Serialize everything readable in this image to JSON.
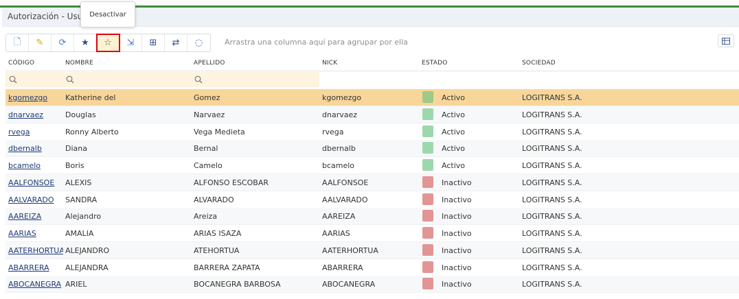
{
  "window": {
    "title": "Autorización - Usu",
    "top_glyph": "ꟸ"
  },
  "tooltip": {
    "text": "Desactivar"
  },
  "toolbar": {
    "buttons": [
      {
        "name": "new-document-icon",
        "glyph": "🗋"
      },
      {
        "name": "edit-document-icon",
        "glyph": "✎"
      },
      {
        "name": "refresh-icon",
        "glyph": "⟳"
      },
      {
        "name": "star-filled-icon",
        "glyph": "★"
      },
      {
        "name": "star-outline-icon",
        "glyph": "☆"
      },
      {
        "name": "export-document-icon",
        "glyph": "⇲"
      },
      {
        "name": "layout-icon",
        "glyph": "⊞"
      },
      {
        "name": "swap-icon",
        "glyph": "⇄"
      },
      {
        "name": "loading-icon",
        "glyph": "◌"
      }
    ],
    "group_hint": "Arrastra una columna aquí para agrupar por ella",
    "column_chooser_icon": "column-chooser-icon"
  },
  "grid": {
    "columns": [
      "CÓDIGO",
      "NOMBRE",
      "APELLIDO",
      "NICK",
      "ESTADO",
      "SOCIEDAD"
    ],
    "search_icon": "🔍",
    "status_colors": {
      "Activo": "#9dd8ad",
      "Inactivo": "#e39494",
      "Activo_selected": "#9ccb86"
    },
    "rows": [
      [
        "kgomezgo",
        "Katherine del",
        "Gomez",
        "kgomezgo",
        "Activo",
        "LOGITRANS S.A."
      ],
      [
        "dnarvaez",
        "Douglas",
        "Narvaez",
        "dnarvaez",
        "Activo",
        "LOGITRANS S.A."
      ],
      [
        "rvega",
        "Ronny Alberto",
        "Vega Medieta",
        "rvega",
        "Activo",
        "LOGITRANS S.A."
      ],
      [
        "dbernalb",
        "Diana",
        "Bernal",
        "dbernalb",
        "Activo",
        "LOGITRANS S.A."
      ],
      [
        "bcamelo",
        "Boris",
        "Camelo",
        "bcamelo",
        "Activo",
        "LOGITRANS S.A."
      ],
      [
        "AALFONSOE",
        "ALEXIS",
        "ALFONSO ESCOBAR",
        "AALFONSOE",
        "Inactivo",
        "LOGITRANS S.A."
      ],
      [
        "AALVARADO",
        "SANDRA",
        "ALVARADO",
        "AALVARADO",
        "Inactivo",
        "LOGITRANS S.A."
      ],
      [
        "AAREIZA",
        "Alejandro",
        "Areiza",
        "AAREIZA",
        "Inactivo",
        "LOGITRANS S.A."
      ],
      [
        "AARIAS",
        "AMALIA",
        "ARIAS ISAZA",
        "AARIAS",
        "Inactivo",
        "LOGITRANS S.A."
      ],
      [
        "AATERHORTUA",
        "ALEJANDRO",
        "ATEHORTUA",
        "AATERHORTUA",
        "Inactivo",
        "LOGITRANS S.A."
      ],
      [
        "ABARRERA",
        "ALEJANDRA",
        "BARRERA ZAPATA",
        "ABARRERA",
        "Inactivo",
        "LOGITRANS S.A."
      ],
      [
        "ABOCANEGRA",
        "ARIEL",
        "BOCANEGRA BARBOSA",
        "ABOCANEGRA",
        "Inactivo",
        "LOGITRANS S.A."
      ]
    ]
  }
}
